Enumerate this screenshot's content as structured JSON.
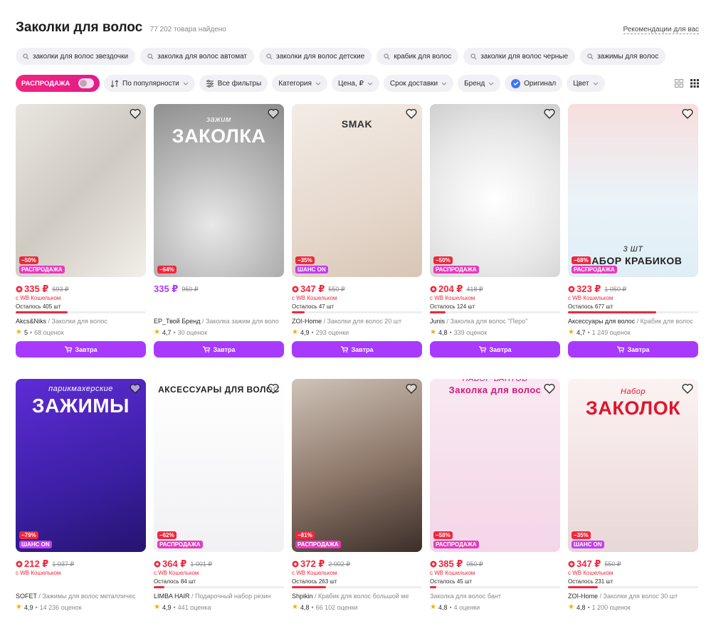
{
  "header": {
    "title": "Заколки для волос",
    "count": "77 202 товара найдено",
    "recommendations": "Рекомендации для вас"
  },
  "chips": [
    "заколки для волос звездочки",
    "заколка для волос автомат",
    "заколки для волос детские",
    "крабик для волос",
    "заколки для волос черные",
    "зажимы для волос"
  ],
  "filters": {
    "sale": "РАСПРОДАЖА",
    "sort": "По популярности",
    "all": "Все фильтры",
    "category": "Категория",
    "price": "Цена, ₽",
    "delivery": "Срок доставки",
    "brand": "Бренд",
    "original": "Оригинал",
    "color": "Цвет"
  },
  "labels": {
    "wallet": "с WB Кошельком",
    "cart": "Завтра",
    "sale_badge": "РАСПРОДАЖА",
    "chance_badge": "ШАНС ON"
  },
  "products": [
    {
      "price": "335 ₽",
      "old": "693 ₽",
      "wallet": true,
      "stock": "Осталось 405 шт",
      "stock_level": 0.4,
      "brand": "Akcs&Niks",
      "cat": " / Заколки для волос",
      "rating": "5",
      "reviews": "68 оценок",
      "discount": "−50%",
      "badge": "sale",
      "img_text": ""
    },
    {
      "price": "335 ₽",
      "old": "950 ₽",
      "wallet": false,
      "stock": "",
      "stock_level": 0,
      "brand": "EP_Твой Бренд",
      "cat": " / Заколка зажим для воло",
      "rating": "4,7",
      "reviews": "30 оценок",
      "discount": "−64%",
      "badge": "",
      "img_text": "ЗАКОЛКА",
      "img_sub": "зажим"
    },
    {
      "price": "347 ₽",
      "old": "550 ₽",
      "wallet": true,
      "stock": "Осталось 47 шт",
      "stock_level": 0.1,
      "brand": "ZOI-Home",
      "cat": " / Заколки для волос 20 шт",
      "rating": "4,9",
      "reviews": "293 оценки",
      "discount": "−35%",
      "badge": "chance",
      "img_text": "SMAK"
    },
    {
      "price": "204 ₽",
      "old": "418 ₽",
      "wallet": true,
      "stock": "Осталось 124 шт",
      "stock_level": 0.12,
      "brand": "Junis",
      "cat": " / Заколка для волос \"Перо\"",
      "rating": "4,8",
      "reviews": "339 оценок",
      "discount": "−50%",
      "badge": "sale",
      "img_text": ""
    },
    {
      "price": "323 ₽",
      "old": "1 050 ₽",
      "wallet": true,
      "stock": "Осталось 677 шт",
      "stock_level": 0.68,
      "brand": "Аксессуары для волос",
      "cat": " / Крабик для волос",
      "rating": "4,7",
      "reviews": "1 249 оценок",
      "discount": "−68%",
      "badge": "sale",
      "img_text": "НАБОР КРАБИКОВ",
      "img_sub": "3 ШТ"
    },
    {
      "price": "212 ₽",
      "old": "1 037 ₽",
      "wallet": true,
      "stock": "",
      "stock_level": 0,
      "brand": "SOFET",
      "cat": " / Зажимы для волос металличес",
      "rating": "4,9",
      "reviews": "14 236 оценок",
      "discount": "−79%",
      "badge": "chance",
      "img_text": "ЗАЖИМЫ",
      "img_sub": "парикмахерские"
    },
    {
      "price": "364 ₽",
      "old": "1 001 ₽",
      "wallet": true,
      "stock": "Осталось 84 шт",
      "stock_level": 0.08,
      "brand": "LIMBA HAIR",
      "cat": " / Подарочный набор резин",
      "rating": "4,9",
      "reviews": "441 оценка",
      "discount": "−62%",
      "badge": "sale",
      "img_text": "АКСЕССУАРЫ ДЛЯ ВОЛОС"
    },
    {
      "price": "372 ₽",
      "old": "2 002 ₽",
      "wallet": true,
      "stock": "Осталось 263 шт",
      "stock_level": 0.26,
      "brand": "Shpikin",
      "cat": " / Крабик для волос большой ме",
      "rating": "4,8",
      "reviews": "66 102 оценки",
      "discount": "−81%",
      "badge": "sale",
      "img_text": ""
    },
    {
      "price": "385 ₽",
      "old": "950 ₽",
      "wallet": true,
      "stock": "Осталось 45 шт",
      "stock_level": 0.05,
      "brand": "",
      "cat": "Заколка для волос бант",
      "rating": "4,8",
      "reviews": "4 оценки",
      "discount": "−58%",
      "badge": "sale",
      "img_text": "Заколка для волос",
      "img_sub": "НАБОР БАНТОВ"
    },
    {
      "price": "347 ₽",
      "old": "550 ₽",
      "wallet": true,
      "stock": "Осталось 231 шт",
      "stock_level": 0.23,
      "brand": "ZOI-Home",
      "cat": " / Заколки для волос 30 шт",
      "rating": "4,8",
      "reviews": "1 200 оценок",
      "discount": "−35%",
      "badge": "chance",
      "img_text": "ЗАКОЛОК",
      "img_sub": "Набор"
    }
  ],
  "colors": {
    "accent": "#a73afd",
    "red": "#f0283c",
    "pink": "#e53bbd"
  }
}
